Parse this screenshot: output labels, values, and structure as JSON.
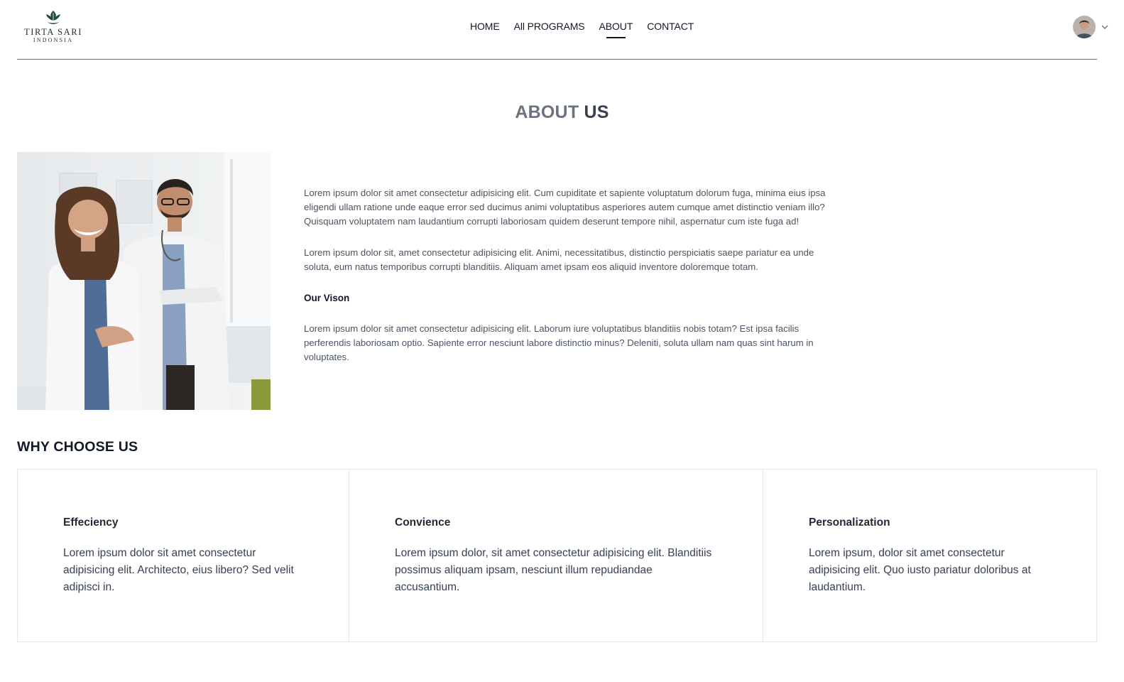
{
  "brand": {
    "name": "TIRTA SARI",
    "subtitle": "INDONSIA"
  },
  "nav": {
    "items": [
      {
        "label": "HOME",
        "active": false
      },
      {
        "label": "All PROGRAMS",
        "active": false
      },
      {
        "label": "ABOUT",
        "active": true
      },
      {
        "label": "CONTACT",
        "active": false
      }
    ]
  },
  "user": {
    "avatar_icon": "user-avatar",
    "menu_icon": "chevron-down-icon"
  },
  "page": {
    "title_light": "ABOUT",
    "title_bold": "US"
  },
  "about": {
    "paragraph1": "Lorem ipsum dolor sit amet consectetur adipisicing elit. Cum cupiditate et sapiente voluptatum dolorum fuga, minima eius ipsa eligendi ullam ratione unde eaque error sed ducimus animi voluptatibus asperiores autem cumque amet distinctio veniam illo? Quisquam voluptatem nam laudantium corrupti laboriosam quidem deserunt tempore nihil, aspernatur cum iste fuga ad!",
    "paragraph2": "Lorem ipsum dolor sit, amet consectetur adipisicing elit. Animi, necessitatibus, distinctio perspiciatis saepe pariatur ea unde soluta, eum natus temporibus corrupti blanditiis. Aliquam amet ipsam eos aliquid inventore doloremque totam.",
    "vision_heading": "Our Vison",
    "vision_text": "Lorem ipsum dolor sit amet consectetur adipisicing elit. Laborum iure voluptatibus blanditiis nobis totam? Est ipsa facilis perferendis laboriosam optio. Sapiente error nesciunt labore distinctio minus? Deleniti, soluta ullam nam quas sint harum in voluptates."
  },
  "why": {
    "title": "WHY CHOOSE US",
    "cards": [
      {
        "title": "Effeciency",
        "text": "Lorem ipsum dolor sit amet consectetur adipisicing elit. Architecto, eius libero? Sed velit adipisci in."
      },
      {
        "title": "Convience",
        "text": "Lorem ipsum dolor, sit amet consectetur adipisicing elit. Blanditiis possimus aliquam ipsam, nesciunt illum repudiandae accusantium."
      },
      {
        "title": "Personalization",
        "text": "Lorem ipsum, dolor sit amet consectetur adipisicing elit. Quo iusto pariatur doloribus at laudantium."
      }
    ]
  }
}
